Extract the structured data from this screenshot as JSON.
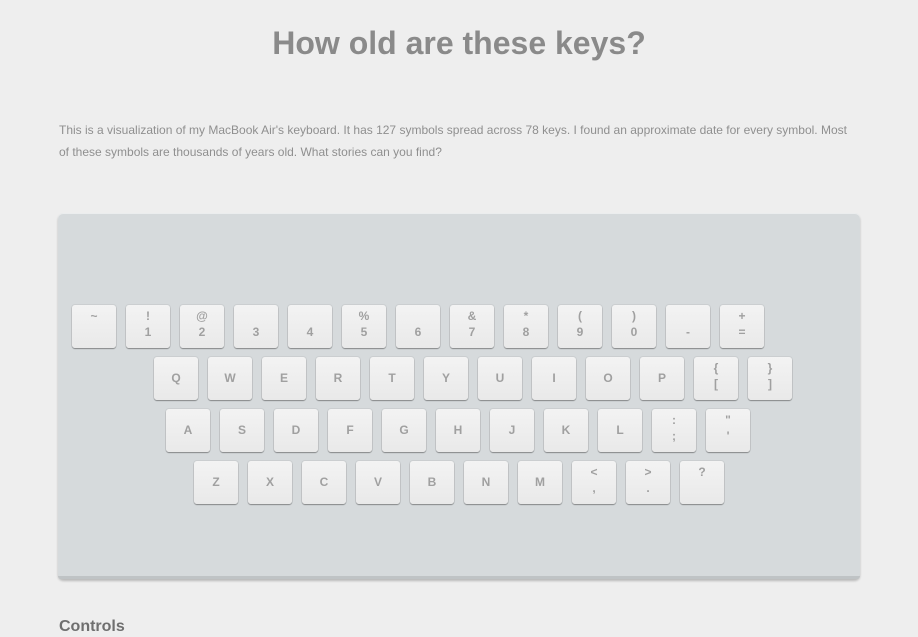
{
  "page": {
    "title": "How old are these keys?",
    "intro": "This is a visualization of my MacBook Air's keyboard. It has 127 symbols spread across 78 keys. I found an approximate date for every symbol. Most of these symbols are thousands of years old. What stories can you find?",
    "controls_heading": "Controls"
  },
  "keyboard": {
    "rows": [
      [
        {
          "top": "~",
          "bottom": ""
        },
        {
          "top": "!",
          "bottom": "1"
        },
        {
          "top": "@",
          "bottom": "2"
        },
        {
          "top": "",
          "bottom": "3"
        },
        {
          "top": "",
          "bottom": "4"
        },
        {
          "top": "%",
          "bottom": "5"
        },
        {
          "top": "",
          "bottom": "6"
        },
        {
          "top": "&",
          "bottom": "7"
        },
        {
          "top": "*",
          "bottom": "8"
        },
        {
          "top": "(",
          "bottom": "9"
        },
        {
          "top": ")",
          "bottom": "0"
        },
        {
          "top": "",
          "bottom": "-"
        },
        {
          "top": "+",
          "bottom": "="
        }
      ],
      [
        {
          "label": "Q"
        },
        {
          "label": "W"
        },
        {
          "label": "E"
        },
        {
          "label": "R"
        },
        {
          "label": "T"
        },
        {
          "label": "Y"
        },
        {
          "label": "U"
        },
        {
          "label": "I"
        },
        {
          "label": "O"
        },
        {
          "label": "P"
        },
        {
          "top": "{",
          "bottom": "["
        },
        {
          "top": "}",
          "bottom": "]"
        }
      ],
      [
        {
          "label": "A"
        },
        {
          "label": "S"
        },
        {
          "label": "D"
        },
        {
          "label": "F"
        },
        {
          "label": "G"
        },
        {
          "label": "H"
        },
        {
          "label": "J"
        },
        {
          "label": "K"
        },
        {
          "label": "L"
        },
        {
          "top": ":",
          "bottom": ";"
        },
        {
          "top": "\"",
          "bottom": "'"
        }
      ],
      [
        {
          "label": "Z"
        },
        {
          "label": "X"
        },
        {
          "label": "C"
        },
        {
          "label": "V"
        },
        {
          "label": "B"
        },
        {
          "label": "N"
        },
        {
          "label": "M"
        },
        {
          "top": "<",
          "bottom": ","
        },
        {
          "top": ">",
          "bottom": "."
        },
        {
          "top": "?",
          "bottom": ""
        }
      ]
    ]
  }
}
